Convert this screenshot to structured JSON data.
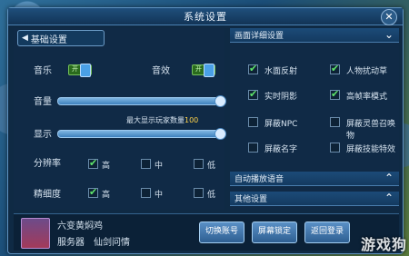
{
  "window": {
    "title": "系统设置",
    "close_glyph": "✕"
  },
  "basic": {
    "tab_label": "基础设置",
    "music_label": "音乐",
    "music_value": "开",
    "sfx_label": "音效",
    "sfx_value": "开",
    "volume_label": "音量",
    "volume_level": 1.0,
    "display_label": "显示",
    "display_level": 1.0,
    "max_players_prefix": "最大显示玩家数量",
    "max_players_value": "100",
    "resolution_label": "分辨率",
    "quality_label": "精细度",
    "opt_high": "高",
    "opt_mid": "中",
    "opt_low": "低",
    "resolution_selected": "high",
    "quality_selected": "high"
  },
  "detail": {
    "header": "画面详细设置",
    "water": {
      "label": "水面反射",
      "checked": true
    },
    "grass": {
      "label": "人物扰动草",
      "checked": true
    },
    "shadow": {
      "label": "实时阴影",
      "checked": true
    },
    "hfr": {
      "label": "高帧率模式",
      "checked": true
    },
    "hide_npc": {
      "label": "屏蔽NPC",
      "checked": false
    },
    "hide_pet": {
      "label": "屏蔽灵兽召唤物",
      "checked": false
    },
    "hide_name": {
      "label": "屏蔽名字",
      "checked": false
    },
    "hide_fx": {
      "label": "屏蔽技能特效",
      "checked": false
    }
  },
  "sections": {
    "auto_voice": "自动播放语音",
    "other": "其他设置"
  },
  "player": {
    "name": "六变黄焖鸡",
    "server_label": "服务器",
    "server_name": "仙剑问情"
  },
  "buttons": {
    "switch_account": "切换账号",
    "lock_screen": "屏幕锁定",
    "third": "返回登录"
  },
  "watermark": "游戏狗"
}
